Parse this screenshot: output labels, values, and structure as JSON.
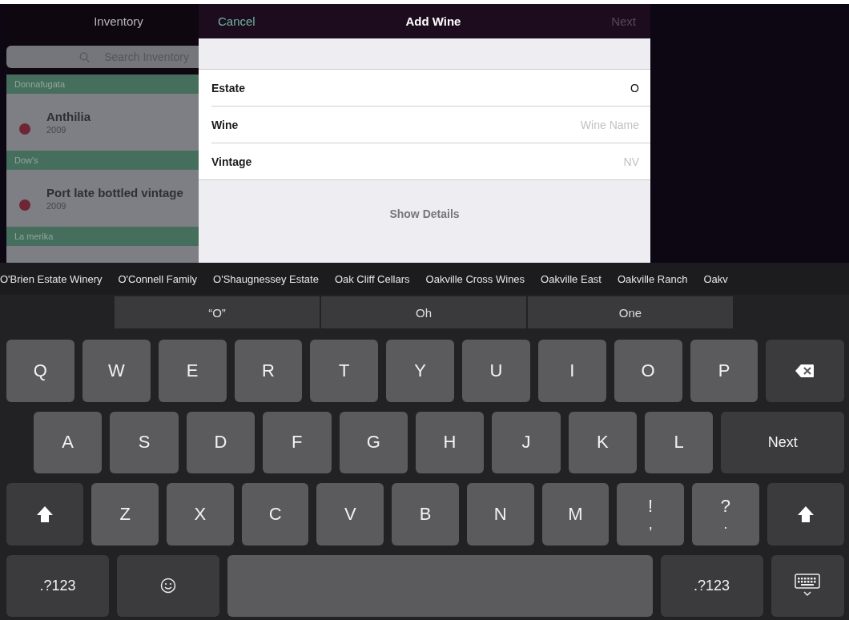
{
  "inventory": {
    "title": "Inventory",
    "search": {
      "placeholder": "Search Inventory"
    },
    "sections": [
      {
        "header": "Donnafugata",
        "items": [
          {
            "name": "Anthilia",
            "year": "2009",
            "color": "#6e2634"
          }
        ]
      },
      {
        "header": "Dow's",
        "items": [
          {
            "name": "Port late bottled vintage",
            "year": "2009",
            "color": "#6e2634"
          }
        ]
      },
      {
        "header": "La merika"
      }
    ]
  },
  "modal": {
    "cancel": "Cancel",
    "title": "Add Wine",
    "next": {
      "label": "Next",
      "disabled": true
    },
    "fields": [
      {
        "label": "Estate",
        "value": "O"
      },
      {
        "label": "Wine",
        "placeholder": "Wine Name"
      },
      {
        "label": "Vintage",
        "placeholder": "NV"
      }
    ],
    "show_details": "Show Details"
  },
  "autocomplete": [
    "O'Brien Estate Winery",
    "O'Connell Family",
    "O'Shaugnessey Estate",
    "Oak Cliff Cellars",
    "Oakville Cross Wines",
    "Oakville East",
    "Oakville Ranch",
    "Oakv"
  ],
  "predictions": [
    "“O”",
    "Oh",
    "One"
  ],
  "keyboard": {
    "rows": [
      [
        {
          "kind": "char",
          "label": "Q"
        },
        {
          "kind": "char",
          "label": "W"
        },
        {
          "kind": "char",
          "label": "E"
        },
        {
          "kind": "char",
          "label": "R"
        },
        {
          "kind": "char",
          "label": "T"
        },
        {
          "kind": "char",
          "label": "Y"
        },
        {
          "kind": "char",
          "label": "U"
        },
        {
          "kind": "char",
          "label": "I"
        },
        {
          "kind": "char",
          "label": "O"
        },
        {
          "kind": "char",
          "label": "P"
        },
        {
          "kind": "backspace"
        }
      ],
      [
        {
          "kind": "char",
          "label": "A"
        },
        {
          "kind": "char",
          "label": "S"
        },
        {
          "kind": "char",
          "label": "D"
        },
        {
          "kind": "char",
          "label": "F"
        },
        {
          "kind": "char",
          "label": "G"
        },
        {
          "kind": "char",
          "label": "H"
        },
        {
          "kind": "char",
          "label": "J"
        },
        {
          "kind": "char",
          "label": "K"
        },
        {
          "kind": "char",
          "label": "L"
        },
        {
          "kind": "action",
          "label": "Next"
        }
      ],
      [
        {
          "kind": "shift"
        },
        {
          "kind": "char",
          "label": "Z"
        },
        {
          "kind": "char",
          "label": "X"
        },
        {
          "kind": "char",
          "label": "C"
        },
        {
          "kind": "char",
          "label": "V"
        },
        {
          "kind": "char",
          "label": "B"
        },
        {
          "kind": "char",
          "label": "N"
        },
        {
          "kind": "char",
          "label": "M"
        },
        {
          "kind": "dual",
          "label": "!",
          "sub": ","
        },
        {
          "kind": "dual",
          "label": "?",
          "sub": "."
        },
        {
          "kind": "shift"
        }
      ]
    ],
    "bottom_bar": {
      "left_mode": ".?123",
      "right_mode": ".?123"
    }
  }
}
